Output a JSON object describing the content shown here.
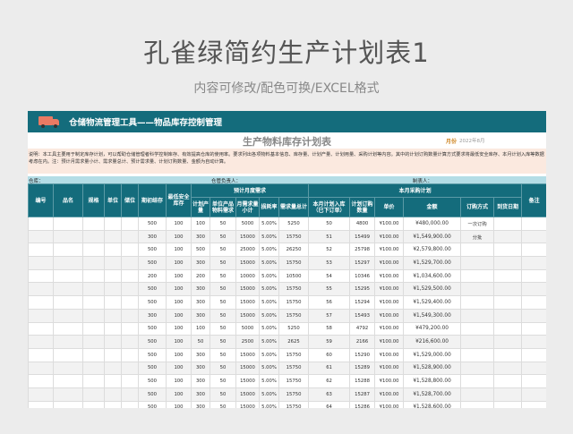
{
  "page": {
    "title": "孔雀绿简约生产计划表1",
    "subtitle": "内容可修改/配色可换/EXCEL格式"
  },
  "banner": {
    "title": "仓储物流管理工具——物品库存控制管理",
    "icon": "truck-icon"
  },
  "sheet": {
    "title": "生产物料库存计划表",
    "month_label": "月份",
    "month_value": "2022年8月",
    "note": "说明：本工具主要用于制定库存计划，可以帮助仓储管理者科学控制库存、有效提高仓库的使用率。要求列出各项物料基本信息、库存量、计划产量、计划用量、采购计划等内容。其中的计划订购数量计算方式要求将最低安全库存、本月计划入库等数据考虑在内。注：预计月需求量小计、需求量总计、预计需求量、计划订购数量、金额为自动计算。",
    "warehouse_label": "仓库：",
    "keeper_label": "仓管负责人：",
    "maker_label": "制表人："
  },
  "headers": {
    "id": "编号",
    "name": "品名",
    "spec": "规格",
    "unit": "单位",
    "loc": "储位",
    "opening": "期初结存",
    "min_stock": "最低安全库存",
    "group_demand": "预计月度需求",
    "group_purchase": "本月采购计划",
    "plan_output": "计划产量",
    "unit_material": "单位产品物料需求",
    "monthly_sub": "月需求量小计",
    "loss_rate": "损耗率",
    "demand_total": "需求量总计",
    "planned_in": "本月计划入库（已下订单）",
    "order_qty": "计划订购数量",
    "price": "单价",
    "amount": "金额",
    "order_method": "订购方式",
    "arrival": "到货日期",
    "remark": "备注"
  },
  "rows": [
    [
      "500",
      "100",
      "100",
      "50",
      "5000",
      "5.00%",
      "5250",
      "50",
      "4800",
      "¥100.00",
      "¥480,000.00",
      "一次订购"
    ],
    [
      "300",
      "100",
      "300",
      "50",
      "15000",
      "5.00%",
      "15750",
      "51",
      "15499",
      "¥100.00",
      "¥1,549,900.00",
      "分批"
    ],
    [
      "500",
      "100",
      "500",
      "50",
      "25000",
      "5.00%",
      "26250",
      "52",
      "25798",
      "¥100.00",
      "¥2,579,800.00",
      ""
    ],
    [
      "500",
      "100",
      "300",
      "50",
      "15000",
      "5.00%",
      "15750",
      "53",
      "15297",
      "¥100.00",
      "¥1,529,700.00",
      ""
    ],
    [
      "200",
      "100",
      "200",
      "50",
      "10000",
      "5.00%",
      "10500",
      "54",
      "10346",
      "¥100.00",
      "¥1,034,600.00",
      ""
    ],
    [
      "500",
      "100",
      "300",
      "50",
      "15000",
      "5.00%",
      "15750",
      "55",
      "15295",
      "¥100.00",
      "¥1,529,500.00",
      ""
    ],
    [
      "500",
      "100",
      "300",
      "50",
      "15000",
      "5.00%",
      "15750",
      "56",
      "15294",
      "¥100.00",
      "¥1,529,400.00",
      ""
    ],
    [
      "300",
      "100",
      "300",
      "50",
      "15000",
      "5.00%",
      "15750",
      "57",
      "15493",
      "¥100.00",
      "¥1,549,300.00",
      ""
    ],
    [
      "500",
      "100",
      "100",
      "50",
      "5000",
      "5.00%",
      "5250",
      "58",
      "4792",
      "¥100.00",
      "¥479,200.00",
      ""
    ],
    [
      "500",
      "100",
      "50",
      "50",
      "2500",
      "5.00%",
      "2625",
      "59",
      "2166",
      "¥100.00",
      "¥216,600.00",
      ""
    ],
    [
      "500",
      "100",
      "300",
      "50",
      "15000",
      "5.00%",
      "15750",
      "60",
      "15290",
      "¥100.00",
      "¥1,529,000.00",
      ""
    ],
    [
      "500",
      "100",
      "300",
      "50",
      "15000",
      "5.00%",
      "15750",
      "61",
      "15289",
      "¥100.00",
      "¥1,528,900.00",
      ""
    ],
    [
      "500",
      "100",
      "300",
      "50",
      "15000",
      "5.00%",
      "15750",
      "62",
      "15288",
      "¥100.00",
      "¥1,528,800.00",
      ""
    ],
    [
      "500",
      "100",
      "300",
      "50",
      "15000",
      "5.00%",
      "15750",
      "63",
      "15287",
      "¥100.00",
      "¥1,528,700.00",
      ""
    ],
    [
      "500",
      "100",
      "300",
      "50",
      "15000",
      "5.00%",
      "15750",
      "64",
      "15286",
      "¥100.00",
      "¥1,528,600.00",
      ""
    ]
  ]
}
